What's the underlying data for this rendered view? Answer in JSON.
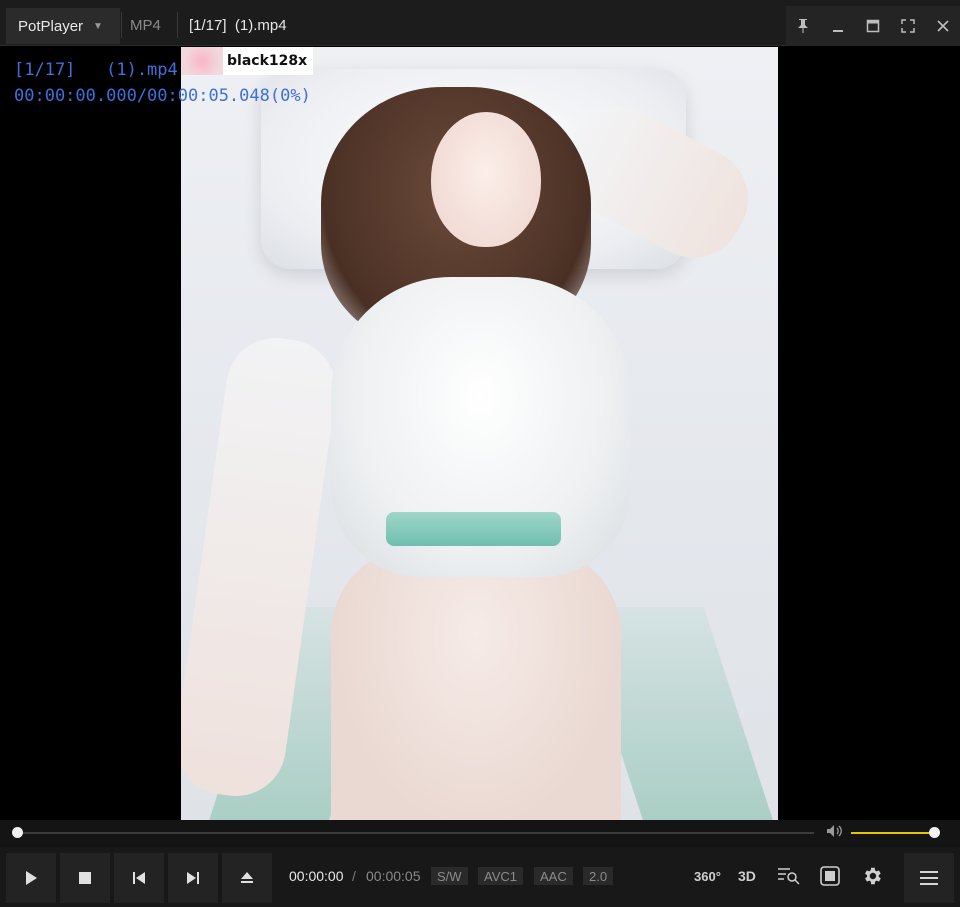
{
  "titlebar": {
    "app_name": "PotPlayer",
    "format": "MP4",
    "title": "[1/17]  (1).mp4",
    "window_controls": [
      "pin-icon",
      "minimize-icon",
      "maximize-icon",
      "fullscreen-icon",
      "close-icon"
    ]
  },
  "watermark": {
    "text": "black128x"
  },
  "osd": {
    "line1": "[1/17]   (1).mp4",
    "line2": "00:00:00.000/00:00:05.048(0%)"
  },
  "seek": {
    "progress": 0.0
  },
  "volume": {
    "level": 1.0,
    "accent_color": "#e5c600"
  },
  "controls": {
    "time_current": "00:00:00",
    "time_separator": "/",
    "time_duration": "00:00:05",
    "badges": [
      "S/W",
      "AVC1",
      "AAC",
      "2.0"
    ],
    "right_icons": {
      "vr": "360°",
      "stereo": "3D"
    }
  }
}
